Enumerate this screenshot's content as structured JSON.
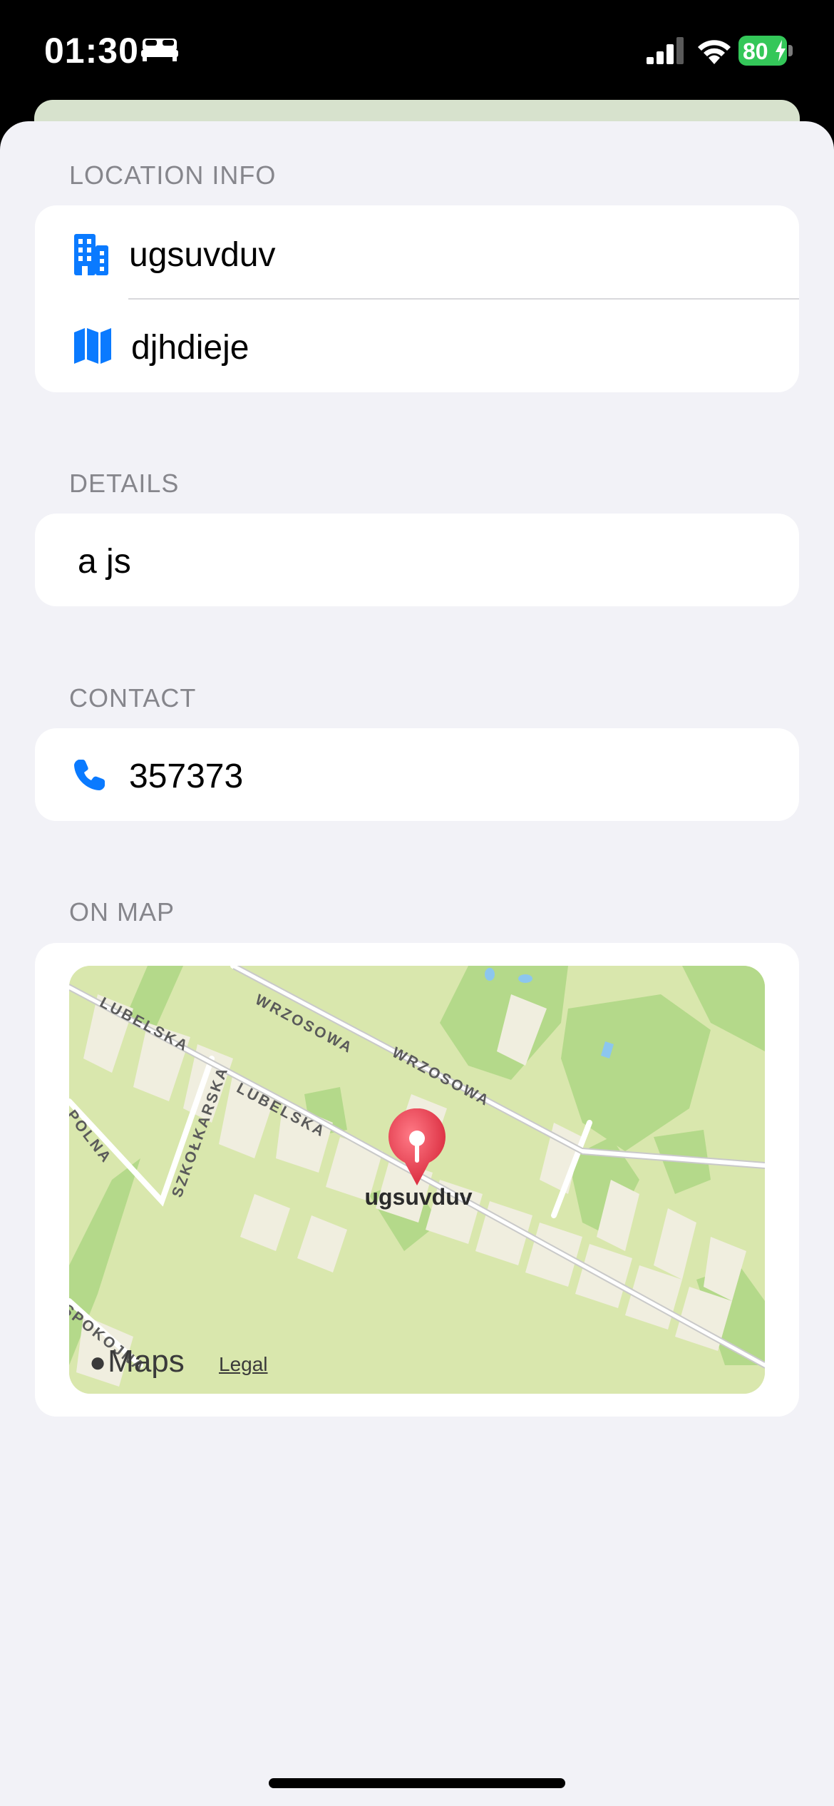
{
  "status_bar": {
    "time": "01:30",
    "battery": "80"
  },
  "sections": {
    "location_info": {
      "header": "LOCATION INFO",
      "name": "ugsuvduv",
      "address": "djhdieje"
    },
    "details": {
      "header": "DETAILS",
      "text": "a js"
    },
    "contact": {
      "header": "CONTACT",
      "phone": "357373"
    },
    "on_map": {
      "header": "ON MAP",
      "pin_label": "ugsuvduv",
      "streets": [
        "WRZOSOWA",
        "WRZOSOWA",
        "LUBELSKA",
        "LUBELSKA",
        "POLNA",
        "SZKOŁKARSKA",
        "SPOKOJNA"
      ],
      "maps_logo": "Maps",
      "legal": "Legal"
    }
  },
  "colors": {
    "accent": "#0a7aff",
    "pin": "#e8374a",
    "battery": "#34c759"
  }
}
